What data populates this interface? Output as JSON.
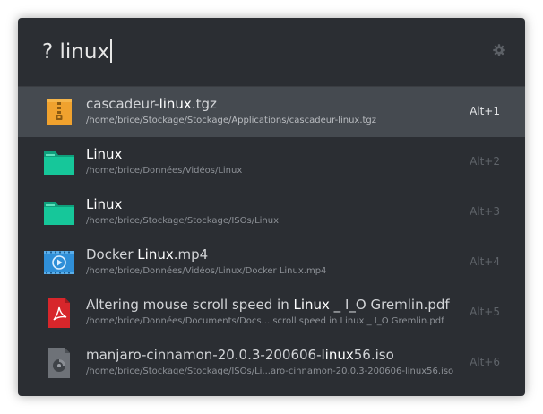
{
  "search": {
    "query": "? linux"
  },
  "icons": {
    "settings": "gear-icon",
    "archive": "archive-icon",
    "folder": "folder-icon",
    "video": "video-file-icon",
    "pdf": "pdf-file-icon",
    "disk_image": "disk-image-icon"
  },
  "colors": {
    "window_bg": "#2b2e33",
    "selected_row": "#454a50",
    "folder_teal": "#16c79a",
    "archive_orange": "#f0a22e",
    "video_blue": "#2f8fd8",
    "pdf_red": "#d7262b"
  },
  "results": [
    {
      "title_pre": "cascadeur-",
      "title_match": "linux",
      "title_post": ".tgz",
      "path": "/home/brice/Stockage/Stockage/Applications/cascadeur-linux.tgz",
      "shortcut": "Alt+1",
      "icon": "archive-icon",
      "selected": true
    },
    {
      "title_pre": "",
      "title_match": "Linux",
      "title_post": "",
      "path": "/home/brice/Données/Vidéos/Linux",
      "shortcut": "Alt+2",
      "icon": "folder-icon",
      "selected": false
    },
    {
      "title_pre": "",
      "title_match": "Linux",
      "title_post": "",
      "path": "/home/brice/Stockage/Stockage/ISOs/Linux",
      "shortcut": "Alt+3",
      "icon": "folder-icon",
      "selected": false
    },
    {
      "title_pre": "Docker ",
      "title_match": "Linux",
      "title_post": ".mp4",
      "path": "/home/brice/Données/Vidéos/Linux/Docker Linux.mp4",
      "shortcut": "Alt+4",
      "icon": "video-file-icon",
      "selected": false
    },
    {
      "title_pre": "Altering mouse scroll speed in ",
      "title_match": "Linux",
      "title_post": " _ I_O Gremlin.pdf",
      "path": "/home/brice/Données/Documents/Docs... scroll speed in Linux _ I_O Gremlin.pdf",
      "shortcut": "Alt+5",
      "icon": "pdf-file-icon",
      "selected": false
    },
    {
      "title_pre": "manjaro-cinnamon-20.0.3-200606-",
      "title_match": "linux",
      "title_post": "56.iso",
      "path": "/home/brice/Stockage/Stockage/ISOs/Li...aro-cinnamon-20.0.3-200606-linux56.iso",
      "shortcut": "Alt+6",
      "icon": "disk-image-icon",
      "selected": false
    }
  ]
}
